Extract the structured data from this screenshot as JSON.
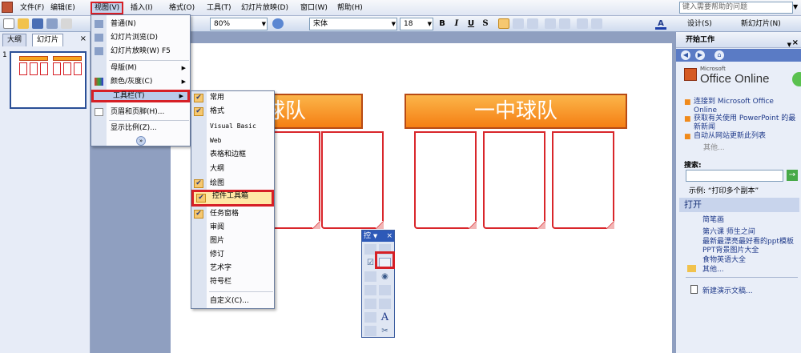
{
  "menubar": {
    "items": [
      "文件(F)",
      "编辑(E)",
      "视图(V)",
      "插入(I)",
      "格式(O)",
      "工具(T)",
      "幻灯片放映(D)",
      "窗口(W)",
      "帮助(H)"
    ],
    "help_placeholder": "键入需要帮助的问题",
    "help_dropdown": "▼"
  },
  "toolbar": {
    "zoom": "80%",
    "font": "宋体",
    "font_size": "18",
    "bold": "B",
    "italic": "I",
    "underline": "U",
    "shadow": "S",
    "design": "设计(S)",
    "new_slide": "新幻灯片(N)",
    "font_color_glyph": "A"
  },
  "outline_pane": {
    "tabs": [
      "大纲",
      "幻灯片"
    ],
    "close": "×",
    "slide_number": "1"
  },
  "slide": {
    "left_title": "中球队",
    "right_title": "一中球队"
  },
  "view_menu": {
    "items": [
      {
        "label": "普通(N)"
      },
      {
        "label": "幻灯片浏览(D)"
      },
      {
        "label": "幻灯片放映(W)",
        "shortcut": "F5"
      },
      {
        "label": "母版(M)",
        "arrow": "▶"
      },
      {
        "label": "颜色/灰度(C)",
        "arrow": "▶"
      },
      {
        "label": "工具栏(T)",
        "arrow": "▶"
      },
      {
        "label": "页眉和页脚(H)..."
      },
      {
        "label": "显示比例(Z)..."
      }
    ],
    "more": "»"
  },
  "toolbar_submenu": {
    "items": [
      {
        "label": "常用",
        "checked": "✔"
      },
      {
        "label": "格式",
        "checked": "✔"
      },
      {
        "label": "Visual Basic",
        "checked": ""
      },
      {
        "label": "Web",
        "checked": ""
      },
      {
        "label": "表格和边框",
        "checked": ""
      },
      {
        "label": "大纲",
        "checked": ""
      },
      {
        "label": "绘图",
        "checked": "✔"
      },
      {
        "label": "控件工具箱",
        "checked": "✔"
      },
      {
        "label": "任务窗格",
        "checked": "✔"
      },
      {
        "label": "审阅",
        "checked": ""
      },
      {
        "label": "图片",
        "checked": ""
      },
      {
        "label": "修订",
        "checked": ""
      },
      {
        "label": "艺术字",
        "checked": ""
      },
      {
        "label": "符号栏",
        "checked": ""
      },
      {
        "label": "自定义(C)...",
        "checked": ""
      }
    ]
  },
  "control_toolbox": {
    "title": "控",
    "title_arrow": "▼",
    "close": "×",
    "text_tool": "A"
  },
  "task_pane": {
    "title": "开始工作",
    "dropdown": "▼",
    "close": "×",
    "nav": [
      "◀",
      "▶",
      "⌂"
    ],
    "logo_ms": "Microsoft",
    "logo_text": "Office Online",
    "links": [
      "连接到 Microsoft Office Online",
      "获取有关使用 PowerPoint 的最新新闻",
      "自动从网站更新此列表"
    ],
    "more1": "其他...",
    "search_label": "搜索:",
    "search_go": "→",
    "search_example": "示例:  “打印多个副本”",
    "open_title": "打开",
    "open_items": [
      "简笔画",
      "第六课 师生之间",
      "最新最漂亮最好看的ppt模板 PPT背景图片大全",
      "食物英语大全",
      "其他..."
    ],
    "new_doc": "新建演示文稿..."
  },
  "colors": {
    "highlight_red": "#d61f26",
    "header_orange": "#f57f13",
    "card_red": "#d9262b"
  }
}
